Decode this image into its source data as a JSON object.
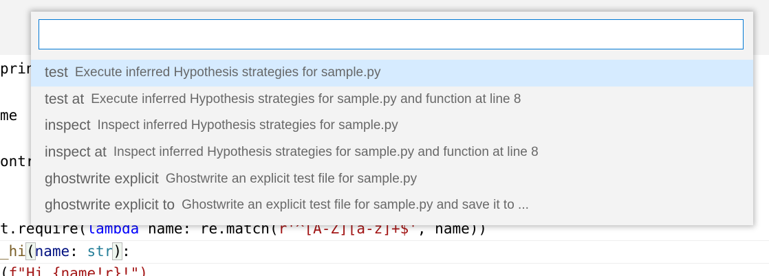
{
  "editor": {
    "left_fragments": [
      "print_",
      "me",
      "ontr"
    ],
    "lines": {
      "require_prefix": "t.require(",
      "lambda_kw": "lambda",
      "require_mid": " name: re.match(",
      "require_str": "r'^[A-Z][a-z]+$'",
      "require_end": ", name))",
      "hi_fn": "_hi",
      "hi_open": "(",
      "hi_param": "name",
      "hi_colon": ": ",
      "hi_type": "str",
      "hi_close": ")",
      "hi_end": ":",
      "fstring_prefix": "(",
      "fstring": "f\"Hi {name!r}!\")"
    }
  },
  "quick_pick": {
    "input_value": "",
    "items": [
      {
        "label": "test",
        "description": "Execute inferred Hypothesis strategies for sample.py",
        "selected": true
      },
      {
        "label": "test at",
        "description": "Execute inferred Hypothesis strategies for sample.py and function at line 8",
        "selected": false
      },
      {
        "label": "inspect",
        "description": "Inspect inferred Hypothesis strategies for sample.py",
        "selected": false
      },
      {
        "label": "inspect at",
        "description": "Inspect inferred Hypothesis strategies for sample.py and function at line 8",
        "selected": false
      },
      {
        "label": "ghostwrite explicit",
        "description": "Ghostwrite an explicit test file for sample.py",
        "selected": false
      },
      {
        "label": "ghostwrite explicit to",
        "description": "Ghostwrite an explicit test file for sample.py and save it to ...",
        "selected": false
      }
    ]
  },
  "colors": {
    "accent": "#0078d4",
    "selection": "#d6ebff",
    "panel": "#f3f3f3",
    "text_muted": "#616161"
  }
}
